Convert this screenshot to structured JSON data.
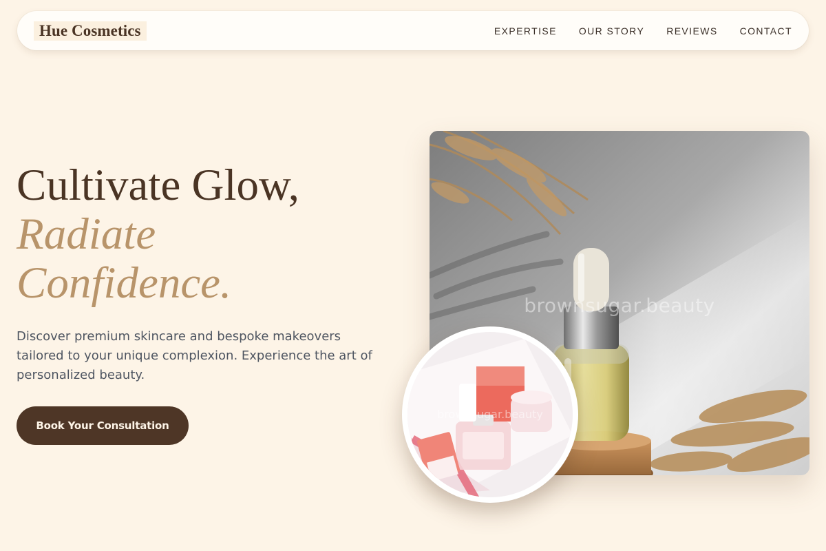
{
  "brand": {
    "name": "Hue Cosmetics"
  },
  "nav": {
    "links": [
      {
        "label": "EXPERTISE"
      },
      {
        "label": "OUR STORY"
      },
      {
        "label": "REVIEWS"
      },
      {
        "label": "CONTACT"
      }
    ]
  },
  "hero": {
    "title_line1": "Cultivate Glow,",
    "title_accent1": "Radiate",
    "title_accent2": "Confidence.",
    "description": "Discover premium skincare and bespoke makeovers tailored to your unique complexion. Experience the art of personalized beauty.",
    "cta_label": "Book Your Consultation"
  },
  "images": {
    "main_watermark": "brownsugar.beauty",
    "inset_watermark": "brownsugar.beauty"
  },
  "colors": {
    "background": "#fdf4e7",
    "text_dark": "#4a3424",
    "accent_gold": "#b8946a",
    "cta_bg": "#4e3626"
  }
}
